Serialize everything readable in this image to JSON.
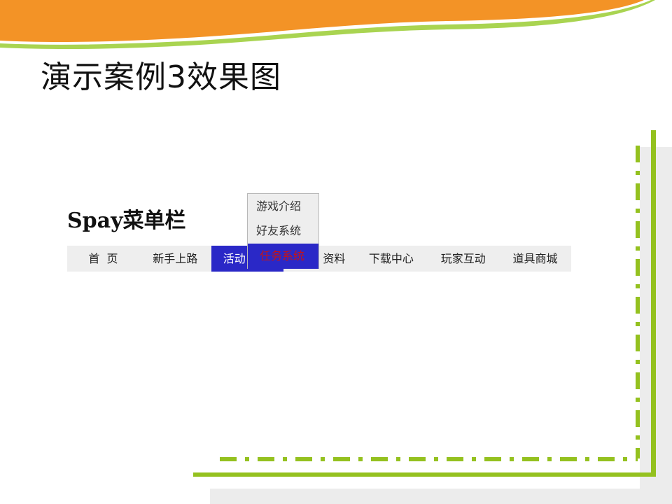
{
  "slide": {
    "title": "演示案例3效果图"
  },
  "demo": {
    "heading": "Spay菜单栏",
    "menu": {
      "items": [
        {
          "label": "首  页",
          "active": false
        },
        {
          "label": "新手上路",
          "active": false
        },
        {
          "label": "活动",
          "active": true
        },
        {
          "label": "资料",
          "active": false
        },
        {
          "label": "下载中心",
          "active": false
        },
        {
          "label": "玩家互动",
          "active": false
        },
        {
          "label": "道具商城",
          "active": false
        }
      ]
    },
    "dropdown": {
      "items": [
        {
          "label": "游戏介绍",
          "hover": false
        },
        {
          "label": "好友系统",
          "hover": false
        },
        {
          "label": "任务系统",
          "hover": true
        }
      ]
    }
  },
  "colors": {
    "accent_orange": "#f39326",
    "accent_green": "#99cc1f",
    "menu_active_bg": "#2a28c7",
    "menu_bar_bg": "#eeeeee",
    "dropdown_hover_text": "#c81414"
  }
}
